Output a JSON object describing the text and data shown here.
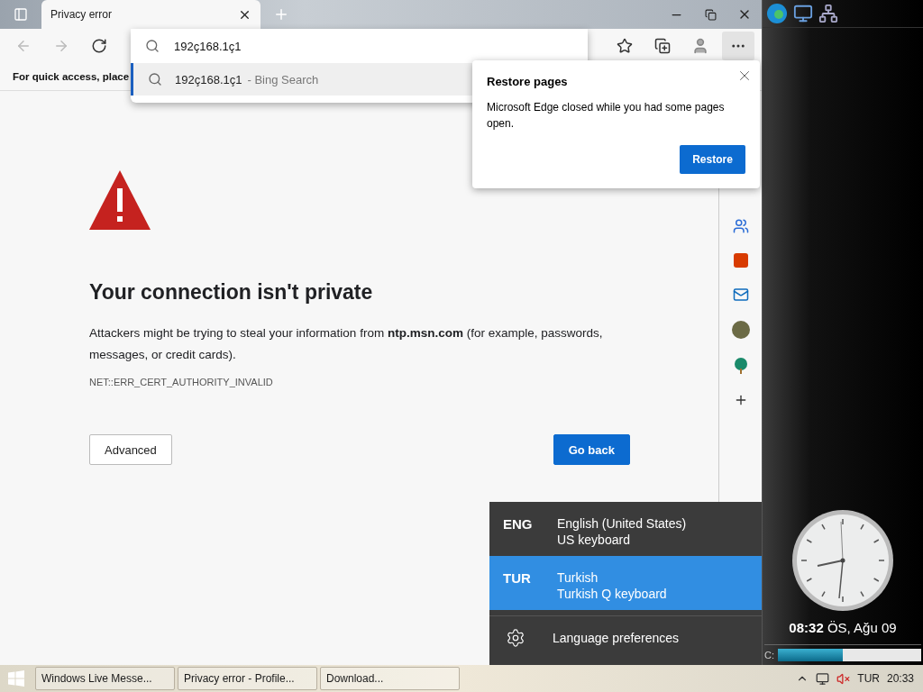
{
  "browser": {
    "tab": {
      "title": "Privacy error"
    },
    "address": {
      "value": "192ç168.1ç1"
    },
    "suggestions": [
      {
        "text": "192ç168.1ç1",
        "hint": "- Bing Search",
        "selected": true
      }
    ],
    "favorites_bar": {
      "text": "For quick access, place"
    }
  },
  "error_page": {
    "heading": "Your connection isn't private",
    "message": "Attackers might be trying to steal your information from **ntp.msn.com** (for example, passwords, messages, or credit cards).",
    "code": "NET::ERR_CERT_AUTHORITY_INVALID",
    "buttons": [
      {
        "label": "Advanced",
        "kind": "secondary"
      },
      {
        "label": "Go back",
        "kind": "primary"
      }
    ]
  },
  "restore_popup": {
    "title": "Restore pages",
    "message": "Microsoft Edge closed while you had some pages open.",
    "button": "Restore"
  },
  "language_menu": {
    "items": [
      {
        "code": "ENG",
        "name": "English (United States)",
        "layout": "US keyboard",
        "selected": false
      },
      {
        "code": "TUR",
        "name": "Turkish",
        "layout": "Turkish Q keyboard",
        "selected": true
      }
    ],
    "preferences": "Language preferences"
  },
  "desktop": {
    "clock_text": "**08:32** ÖS, Ağu 09",
    "drive": {
      "label": "C:",
      "level": 0.45
    }
  },
  "taskbar": {
    "items": [
      {
        "label": "Windows Live Messe..."
      },
      {
        "label": "Privacy error - Profile..."
      },
      {
        "label": "Download..."
      }
    ],
    "language": "TUR",
    "time": "20:33"
  }
}
